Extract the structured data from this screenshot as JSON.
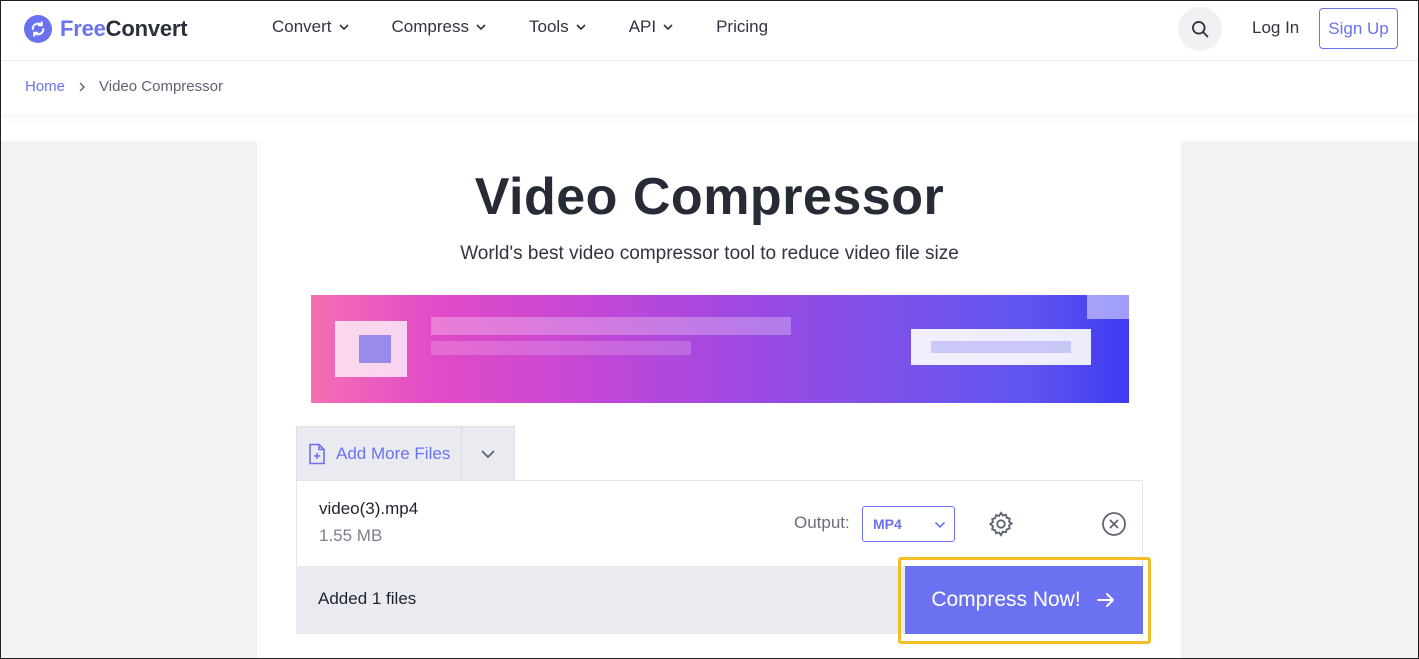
{
  "brand": {
    "name_part1": "Free",
    "name_part2": "Convert",
    "accent_color": "#6b72f2"
  },
  "nav": {
    "items": [
      {
        "label": "Convert",
        "has_dropdown": true
      },
      {
        "label": "Compress",
        "has_dropdown": true
      },
      {
        "label": "Tools",
        "has_dropdown": true
      },
      {
        "label": "API",
        "has_dropdown": true
      },
      {
        "label": "Pricing",
        "has_dropdown": false
      }
    ],
    "search_icon": "search-icon",
    "login_label": "Log In",
    "signup_label": "Sign Up"
  },
  "breadcrumb": {
    "home": "Home",
    "separator_icon": "chevron-right-icon",
    "current": "Video Compressor"
  },
  "page": {
    "title": "Video Compressor",
    "subtitle": "World's best video compressor tool to reduce video file size"
  },
  "uploader": {
    "add_more_label": "Add More Files",
    "file": {
      "name": "video(3).mp4",
      "size": "1.55 MB"
    },
    "output_label": "Output:",
    "output_value": "MP4",
    "added_count_text": "Added 1 files",
    "compress_label": "Compress Now!",
    "highlight_color": "#f2be25"
  }
}
